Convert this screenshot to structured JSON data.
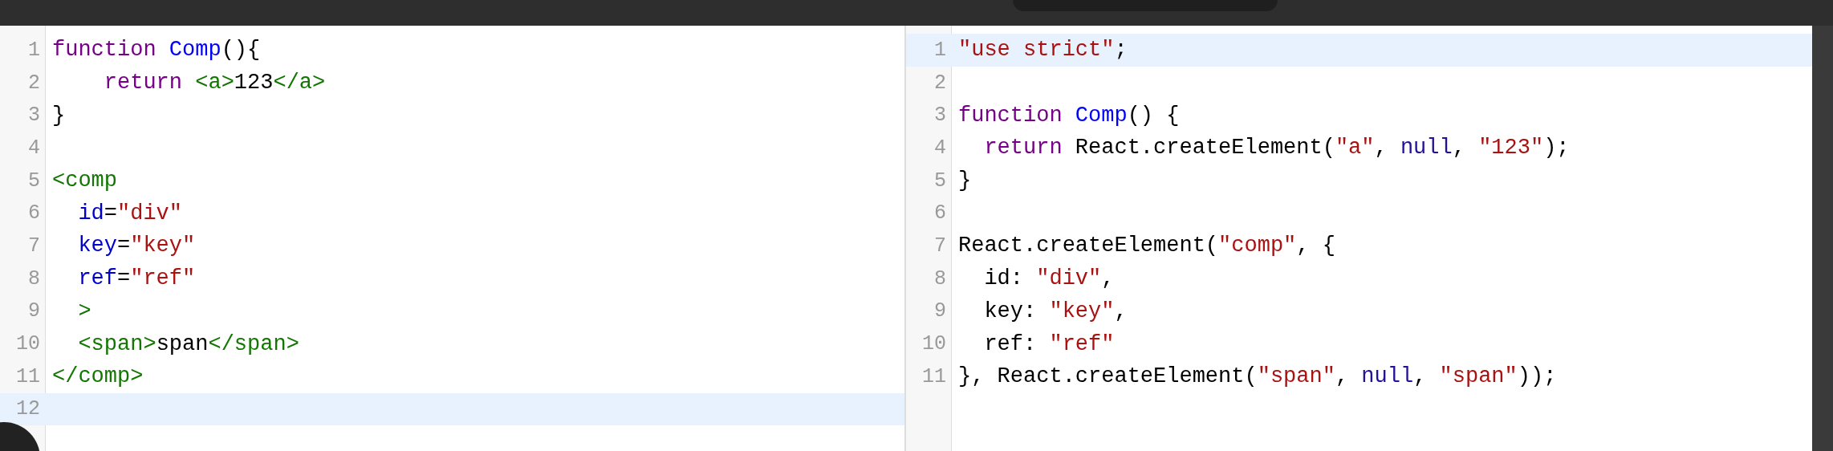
{
  "editors": [
    {
      "lines": [
        {
          "number": "1",
          "active": false,
          "tokens": [
            {
              "kind": "keyword",
              "text": "function "
            },
            {
              "kind": "def",
              "text": "Comp"
            },
            {
              "kind": "plain",
              "text": "(){"
            }
          ]
        },
        {
          "number": "2",
          "active": false,
          "tokens": [
            {
              "kind": "keyword",
              "text": "    return "
            },
            {
              "kind": "tag",
              "text": "<a>"
            },
            {
              "kind": "plain",
              "text": "123"
            },
            {
              "kind": "tag",
              "text": "</a>"
            }
          ]
        },
        {
          "number": "3",
          "active": false,
          "tokens": [
            {
              "kind": "plain",
              "text": "}"
            }
          ]
        },
        {
          "number": "4",
          "active": false
        },
        {
          "number": "5",
          "active": false,
          "tokens": [
            {
              "kind": "tag",
              "text": "<comp"
            }
          ]
        },
        {
          "number": "6",
          "active": false,
          "tokens": [
            {
              "kind": "attr",
              "text": "  id"
            },
            {
              "kind": "plain",
              "text": "="
            },
            {
              "kind": "string",
              "text": "\"div\""
            }
          ]
        },
        {
          "number": "7",
          "active": false,
          "tokens": [
            {
              "kind": "attr",
              "text": "  key"
            },
            {
              "kind": "plain",
              "text": "="
            },
            {
              "kind": "string",
              "text": "\"key\""
            }
          ]
        },
        {
          "number": "8",
          "active": false,
          "tokens": [
            {
              "kind": "attr",
              "text": "  ref"
            },
            {
              "kind": "plain",
              "text": "="
            },
            {
              "kind": "string",
              "text": "\"ref\""
            }
          ]
        },
        {
          "number": "9",
          "active": false,
          "tokens": [
            {
              "kind": "tag",
              "text": "  >"
            }
          ]
        },
        {
          "number": "10",
          "active": false,
          "tokens": [
            {
              "kind": "tag",
              "text": "  <span>"
            },
            {
              "kind": "plain",
              "text": "span"
            },
            {
              "kind": "tag",
              "text": "</span>"
            }
          ]
        },
        {
          "number": "11",
          "active": false,
          "tokens": [
            {
              "kind": "tag",
              "text": "</comp>"
            }
          ]
        },
        {
          "number": "12",
          "active": true
        }
      ]
    },
    {
      "lines": [
        {
          "number": "1",
          "active": true,
          "tokens": [
            {
              "kind": "string",
              "text": "\"use strict\""
            },
            {
              "kind": "plain",
              "text": ";"
            }
          ]
        },
        {
          "number": "2",
          "active": false
        },
        {
          "number": "3",
          "active": false,
          "tokens": [
            {
              "kind": "keyword",
              "text": "function "
            },
            {
              "kind": "def",
              "text": "Comp"
            },
            {
              "kind": "plain",
              "text": "() {"
            }
          ]
        },
        {
          "number": "4",
          "active": false,
          "tokens": [
            {
              "kind": "keyword",
              "text": "  return"
            },
            {
              "kind": "plain",
              "text": " React.createElement("
            },
            {
              "kind": "string",
              "text": "\"a\""
            },
            {
              "kind": "plain",
              "text": ", "
            },
            {
              "kind": "atom",
              "text": "null"
            },
            {
              "kind": "plain",
              "text": ", "
            },
            {
              "kind": "string",
              "text": "\"123\""
            },
            {
              "kind": "plain",
              "text": ");"
            }
          ]
        },
        {
          "number": "5",
          "active": false,
          "tokens": [
            {
              "kind": "plain",
              "text": "}"
            }
          ]
        },
        {
          "number": "6",
          "active": false
        },
        {
          "number": "7",
          "active": false,
          "tokens": [
            {
              "kind": "plain",
              "text": "React.createElement("
            },
            {
              "kind": "string",
              "text": "\"comp\""
            },
            {
              "kind": "plain",
              "text": ", {"
            }
          ]
        },
        {
          "number": "8",
          "active": false,
          "tokens": [
            {
              "kind": "plain",
              "text": "  id: "
            },
            {
              "kind": "string",
              "text": "\"div\""
            },
            {
              "kind": "plain",
              "text": ","
            }
          ]
        },
        {
          "number": "9",
          "active": false,
          "tokens": [
            {
              "kind": "plain",
              "text": "  key: "
            },
            {
              "kind": "string",
              "text": "\"key\""
            },
            {
              "kind": "plain",
              "text": ","
            }
          ]
        },
        {
          "number": "10",
          "active": false,
          "tokens": [
            {
              "kind": "plain",
              "text": "  ref: "
            },
            {
              "kind": "string",
              "text": "\"ref\""
            }
          ]
        },
        {
          "number": "11",
          "active": false,
          "tokens": [
            {
              "kind": "plain",
              "text": "}, React.createElement("
            },
            {
              "kind": "string",
              "text": "\"span\""
            },
            {
              "kind": "plain",
              "text": ", "
            },
            {
              "kind": "atom",
              "text": "null"
            },
            {
              "kind": "plain",
              "text": ", "
            },
            {
              "kind": "string",
              "text": "\"span\""
            },
            {
              "kind": "plain",
              "text": "));"
            }
          ]
        }
      ]
    }
  ]
}
